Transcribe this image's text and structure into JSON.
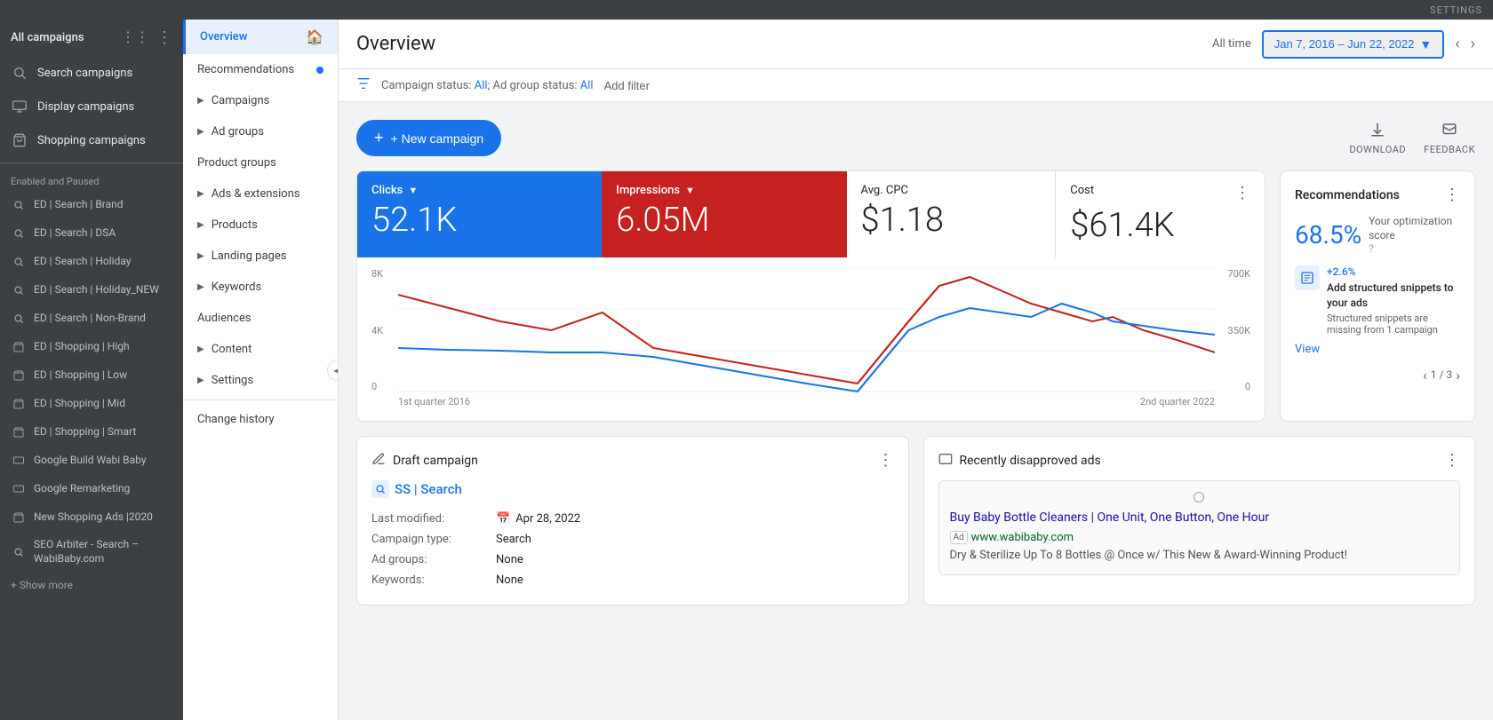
{
  "topbar": {
    "label": "SETTINGS"
  },
  "sidebar": {
    "header": {
      "title": "All campaigns"
    },
    "items": [
      {
        "id": "search-campaigns",
        "label": "Search campaigns",
        "icon": "🔍"
      },
      {
        "id": "display-campaigns",
        "label": "Display campaigns",
        "icon": "🖼"
      },
      {
        "id": "shopping-campaigns",
        "label": "Shopping campaigns",
        "icon": "🛒"
      }
    ],
    "section_label": "Enabled and Paused",
    "campaigns": [
      {
        "id": "ed-search-brand",
        "label": "ED | Search | Brand",
        "icon": "🔍"
      },
      {
        "id": "ed-search-dsa",
        "label": "ED | Search | DSA",
        "icon": "🔍"
      },
      {
        "id": "ed-search-holiday",
        "label": "ED | Search | Holiday",
        "icon": "🔍"
      },
      {
        "id": "ed-search-holiday-new",
        "label": "ED | Search | Holiday_NEW",
        "icon": "🔍"
      },
      {
        "id": "ed-search-non-brand",
        "label": "ED | Search | Non-Brand",
        "icon": "🔍"
      },
      {
        "id": "ed-shopping-high",
        "label": "ED | Shopping | High",
        "icon": "🛒"
      },
      {
        "id": "ed-shopping-low",
        "label": "ED | Shopping | Low",
        "icon": "🛒"
      },
      {
        "id": "ed-shopping-mid",
        "label": "ED | Shopping | Mid",
        "icon": "🛒"
      },
      {
        "id": "ed-shopping-smart",
        "label": "ED | Shopping | Smart",
        "icon": "🛒"
      },
      {
        "id": "google-build-wabi-baby",
        "label": "Google Build Wabi Baby",
        "icon": "🖼"
      },
      {
        "id": "google-remarketing",
        "label": "Google Remarketing",
        "icon": "🖼"
      },
      {
        "id": "new-shopping-ads-2020",
        "label": "New Shopping Ads |2020",
        "icon": "🛒"
      },
      {
        "id": "seo-arbiter",
        "label": "SEO Arbiter - Search – WabiBaby.com",
        "icon": "🔍"
      }
    ],
    "show_more": "+ Show more"
  },
  "secondary_nav": {
    "items": [
      {
        "id": "overview",
        "label": "Overview",
        "active": true,
        "has_home": true
      },
      {
        "id": "recommendations",
        "label": "Recommendations",
        "has_dot": true
      },
      {
        "id": "campaigns",
        "label": "Campaigns",
        "has_arrow": true
      },
      {
        "id": "ad-groups",
        "label": "Ad groups",
        "has_arrow": true
      },
      {
        "id": "product-groups",
        "label": "Product groups"
      },
      {
        "id": "ads-extensions",
        "label": "Ads & extensions",
        "has_arrow": true
      },
      {
        "id": "products",
        "label": "Products",
        "has_arrow": true
      },
      {
        "id": "landing-pages",
        "label": "Landing pages",
        "has_arrow": true
      },
      {
        "id": "keywords",
        "label": "Keywords",
        "has_arrow": true
      },
      {
        "id": "audiences",
        "label": "Audiences"
      },
      {
        "id": "content",
        "label": "Content",
        "has_arrow": true
      },
      {
        "id": "settings",
        "label": "Settings",
        "has_arrow": true
      },
      {
        "id": "change-history",
        "label": "Change history"
      }
    ]
  },
  "header": {
    "title": "Overview",
    "all_time_label": "All time",
    "date_range": "Jan 7, 2016 – Jun 22, 2022"
  },
  "filter_bar": {
    "campaign_status_label": "Campaign status:",
    "campaign_status_value": "All",
    "ad_group_status_label": "Ad group status:",
    "ad_group_status_value": "All",
    "add_filter": "Add filter"
  },
  "toolbar": {
    "new_campaign_label": "+ New campaign",
    "download_label": "DOWNLOAD",
    "feedback_label": "FEEDBACK"
  },
  "metrics": {
    "clicks": {
      "label": "Clicks",
      "value": "52.1K"
    },
    "impressions": {
      "label": "Impressions",
      "value": "6.05M"
    },
    "avg_cpc": {
      "label": "Avg. CPC",
      "value": "$1.18"
    },
    "cost": {
      "label": "Cost",
      "value": "$61.4K"
    }
  },
  "chart": {
    "y_left_labels": [
      "8K",
      "4K",
      "0"
    ],
    "y_right_labels": [
      "700K",
      "350K",
      "0"
    ],
    "x_labels": [
      "1st quarter 2016",
      "2nd quarter 2022"
    ]
  },
  "recommendations": {
    "title": "Recommendations",
    "score": "68.5%",
    "score_label": "Your optimization score",
    "badge": "+2.6%",
    "rec_title": "Add structured snippets to your ads",
    "rec_desc": "Structured snippets are missing from 1 campaign",
    "view_link": "View",
    "pagination": "1 / 3"
  },
  "draft_campaign": {
    "card_title": "Draft campaign",
    "campaign_name": "SS | Search",
    "last_modified_label": "Last modified:",
    "last_modified_value": "Apr 28, 2022",
    "campaign_type_label": "Campaign type:",
    "campaign_type_value": "Search",
    "ad_groups_label": "Ad groups:",
    "ad_groups_value": "None",
    "keywords_label": "Keywords:",
    "keywords_value": "None"
  },
  "disapproved_ads": {
    "card_title": "Recently disapproved ads",
    "ad_title": "Buy Baby Bottle Cleaners | One Unit, One Button, One Hour",
    "ad_url": "www.wabibaby.com",
    "ad_desc": "Dry & Sterilize Up To 8 Bottles @ Once w/ This New & Award-Winning Product!"
  }
}
